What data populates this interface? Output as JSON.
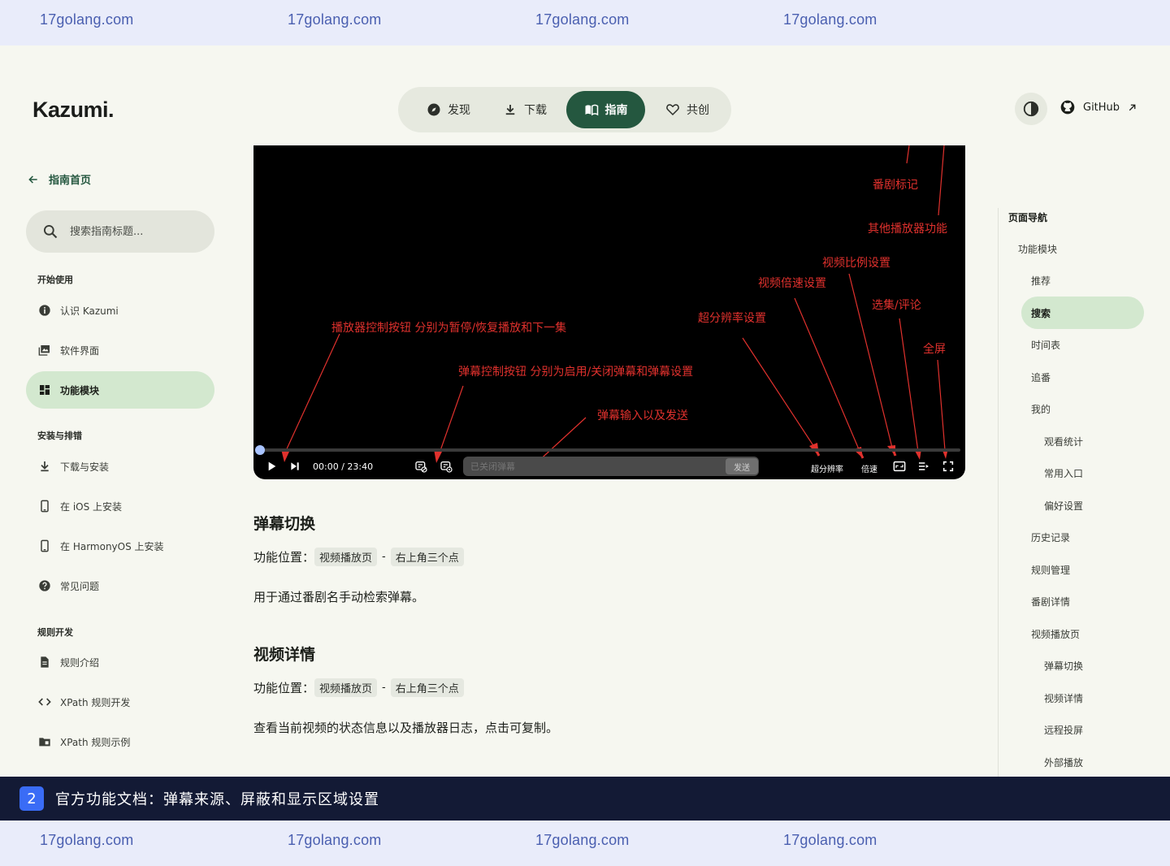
{
  "watermark": {
    "text": "17golang.com"
  },
  "header": {
    "logo": "Kazumi.",
    "nav": [
      {
        "label": "发现",
        "icon": "compass-icon"
      },
      {
        "label": "下载",
        "icon": "download-icon"
      },
      {
        "label": "指南",
        "icon": "book-icon",
        "active": true
      },
      {
        "label": "共创",
        "icon": "heart-icon"
      }
    ],
    "github_label": "GitHub",
    "accent_color": "#24573f"
  },
  "sidebar": {
    "back_label": "指南首页",
    "search_placeholder": "搜索指南标题...",
    "sections": [
      {
        "title": "开始使用",
        "items": [
          {
            "label": "认识 Kazumi",
            "icon": "info-icon"
          },
          {
            "label": "软件界面",
            "icon": "image-icon"
          },
          {
            "label": "功能模块",
            "icon": "dashboard-icon",
            "active": true
          }
        ]
      },
      {
        "title": "安装与排错",
        "items": [
          {
            "label": "下载与安装",
            "icon": "download-icon"
          },
          {
            "label": "在 iOS 上安装",
            "icon": "phone-icon"
          },
          {
            "label": "在 HarmonyOS 上安装",
            "icon": "phone-icon"
          },
          {
            "label": "常见问题",
            "icon": "help-icon"
          }
        ]
      },
      {
        "title": "规则开发",
        "items": [
          {
            "label": "规则介绍",
            "icon": "document-icon"
          },
          {
            "label": "XPath 规则开发",
            "icon": "code-icon"
          },
          {
            "label": "XPath 规则示例",
            "icon": "folder-icon"
          }
        ]
      }
    ]
  },
  "video": {
    "annotations": [
      "番剧标记",
      "其他播放器功能",
      "视频比例设置",
      "视频倍速设置",
      "选集/评论",
      "超分辨率设置",
      "播放器控制按钮 分别为暂停/恢复播放和下一集",
      "全屏",
      "弹幕控制按钮 分别为启用/关闭弹幕和弹幕设置",
      "弹幕输入以及发送"
    ],
    "time": "00:00 / 23:40",
    "danmaku_placeholder": "已关闭弹幕",
    "send_label": "发送",
    "super_resolution_label": "超分辨率",
    "speed_label": "倍速"
  },
  "content": {
    "sections": [
      {
        "title": "弹幕切换",
        "location_label": "功能位置：",
        "loc1": "视频播放页",
        "loc2": "右上角三个点",
        "desc": "用于通过番剧名手动检索弹幕。"
      },
      {
        "title": "视频详情",
        "location_label": "功能位置：",
        "loc1": "视频播放页",
        "loc2": "右上角三个点",
        "desc": "查看当前视频的状态信息以及播放器日志，点击可复制。"
      }
    ],
    "dash": "-"
  },
  "toc": {
    "title": "页面导航",
    "items": [
      {
        "label": "功能模块",
        "level": 1
      },
      {
        "label": "推荐",
        "level": 2
      },
      {
        "label": "搜索",
        "level": 2,
        "active": true
      },
      {
        "label": "时间表",
        "level": 2
      },
      {
        "label": "追番",
        "level": 2
      },
      {
        "label": "我的",
        "level": 2
      },
      {
        "label": "观看统计",
        "level": 3
      },
      {
        "label": "常用入口",
        "level": 3
      },
      {
        "label": "偏好设置",
        "level": 3
      },
      {
        "label": "历史记录",
        "level": 2
      },
      {
        "label": "规则管理",
        "level": 2
      },
      {
        "label": "番剧详情",
        "level": 2
      },
      {
        "label": "视频播放页",
        "level": 2
      },
      {
        "label": "弹幕切换",
        "level": 3
      },
      {
        "label": "视频详情",
        "level": 3
      },
      {
        "label": "远程投屏",
        "level": 3
      },
      {
        "label": "外部播放",
        "level": 3
      }
    ]
  },
  "caption": {
    "badge": "2",
    "text": "官方功能文档：弹幕来源、屏蔽和显示区域设置"
  }
}
